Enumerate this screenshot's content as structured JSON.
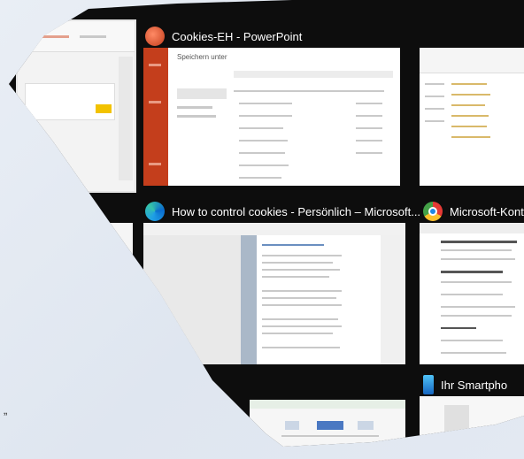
{
  "colors": {
    "ppt": "#c43e1c",
    "bg": "#0d0d0d",
    "selected": "#e6e6e6"
  },
  "windows": [
    {
      "id": "ppt-left",
      "app_icon": "powerpoint-icon",
      "title": ""
    },
    {
      "id": "ppt-main",
      "app_icon": "powerpoint-icon",
      "title": "Cookies-EH - PowerPoint"
    },
    {
      "id": "explorer",
      "app_icon": "",
      "title": ""
    },
    {
      "id": "edge",
      "app_icon": "edge-icon",
      "title": "How to control cookies - Persönlich – Microsoft..."
    },
    {
      "id": "chrome",
      "app_icon": "chrome-icon",
      "title": "Microsoft-Konto | I"
    },
    {
      "id": "phone",
      "app_icon": "phone-icon",
      "title": "Ihr Smartpho"
    }
  ],
  "ppt_dialog": {
    "heading": "Speichern unter"
  },
  "stray_text": "„"
}
